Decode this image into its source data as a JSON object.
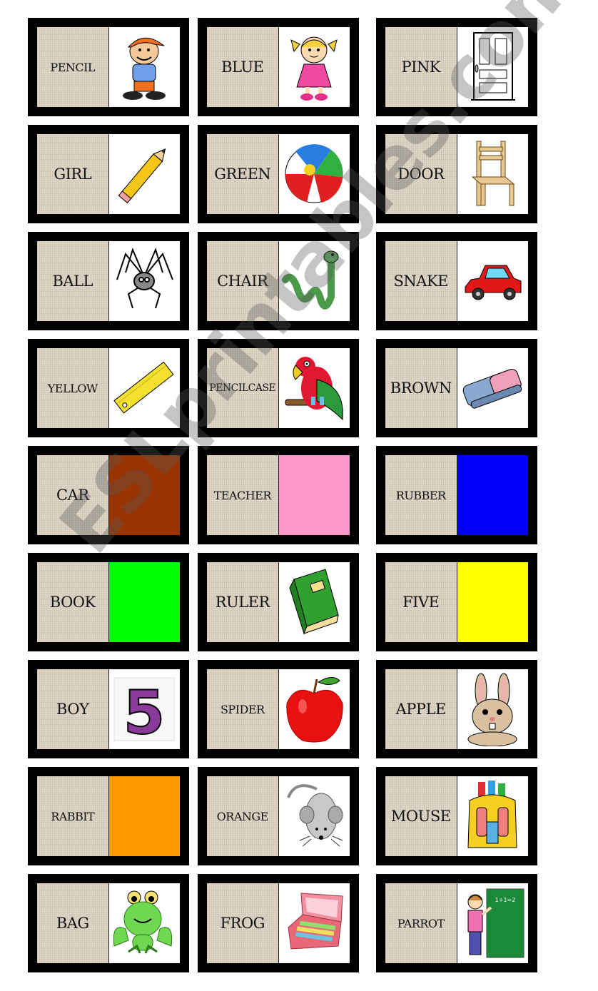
{
  "watermark": "ESLprintables.com",
  "cards": [
    {
      "word": "PENCIL",
      "picture": "boy",
      "kind": "image"
    },
    {
      "word": "BLUE",
      "picture": "girl",
      "kind": "image"
    },
    {
      "word": "PINK",
      "picture": "door",
      "kind": "image"
    },
    {
      "word": "GIRL",
      "picture": "pencil",
      "kind": "image"
    },
    {
      "word": "GREEN",
      "picture": "ball",
      "kind": "image"
    },
    {
      "word": "DOOR",
      "picture": "chair",
      "kind": "image"
    },
    {
      "word": "BALL",
      "picture": "spider",
      "kind": "image"
    },
    {
      "word": "CHAIR",
      "picture": "snake",
      "kind": "image"
    },
    {
      "word": "SNAKE",
      "picture": "car",
      "kind": "image"
    },
    {
      "word": "YELLOW",
      "picture": "ruler",
      "kind": "image"
    },
    {
      "word": "PENCILCASE",
      "picture": "parrot",
      "kind": "image"
    },
    {
      "word": "BROWN",
      "picture": "rubber",
      "kind": "image"
    },
    {
      "word": "CAR",
      "picture": "brown",
      "kind": "color",
      "color": "#993300"
    },
    {
      "word": "TEACHER",
      "picture": "pink",
      "kind": "color",
      "color": "#ff99cc"
    },
    {
      "word": "RUBBER",
      "picture": "blue",
      "kind": "color",
      "color": "#0000ff"
    },
    {
      "word": "BOOK",
      "picture": "green",
      "kind": "color",
      "color": "#00ff00"
    },
    {
      "word": "RULER",
      "picture": "book",
      "kind": "image"
    },
    {
      "word": "FIVE",
      "picture": "yellow",
      "kind": "color",
      "color": "#ffff00"
    },
    {
      "word": "BOY",
      "picture": "five",
      "kind": "image"
    },
    {
      "word": "SPIDER",
      "picture": "apple",
      "kind": "image"
    },
    {
      "word": "APPLE",
      "picture": "rabbit",
      "kind": "image"
    },
    {
      "word": "RABBIT",
      "picture": "orange",
      "kind": "color",
      "color": "#ff9900"
    },
    {
      "word": "ORANGE",
      "picture": "mouse",
      "kind": "image"
    },
    {
      "word": "MOUSE",
      "picture": "bag",
      "kind": "image"
    },
    {
      "word": "BAG",
      "picture": "frog",
      "kind": "image"
    },
    {
      "word": "FROG",
      "picture": "pencilcase",
      "kind": "image"
    },
    {
      "word": "PARROT",
      "picture": "teacher",
      "kind": "image"
    }
  ]
}
